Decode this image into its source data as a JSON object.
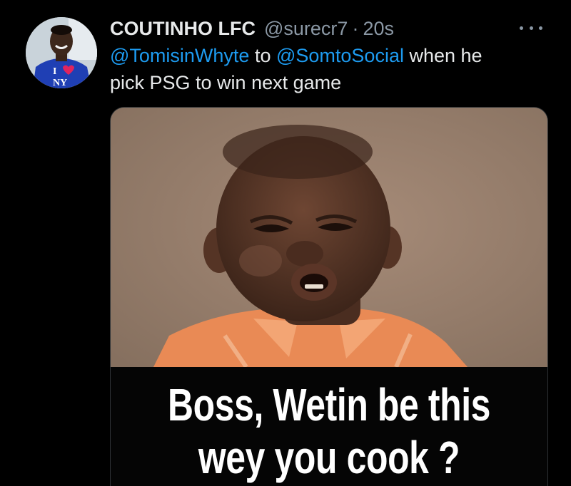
{
  "tweet": {
    "author": {
      "display_name": "COUTINHO LFC",
      "handle": "@surecr7",
      "avatar_text": "I ❤ NY"
    },
    "separator": "·",
    "time": "20s",
    "text": {
      "mention1": "@TomisinWhyte",
      "word_to": " to ",
      "mention2": "@SomtoSocial",
      "rest_line1": " when he",
      "rest_line2": "pick PSG to win next game"
    },
    "menu_icon": "more-horizontal-icon",
    "media": {
      "caption_line1": "Boss, Wetin be this",
      "caption_line2": "wey you cook ?"
    }
  },
  "colors": {
    "background": "#000000",
    "text": "#e7e9ea",
    "secondary": "#8b98a5",
    "link": "#1d9bf0"
  }
}
